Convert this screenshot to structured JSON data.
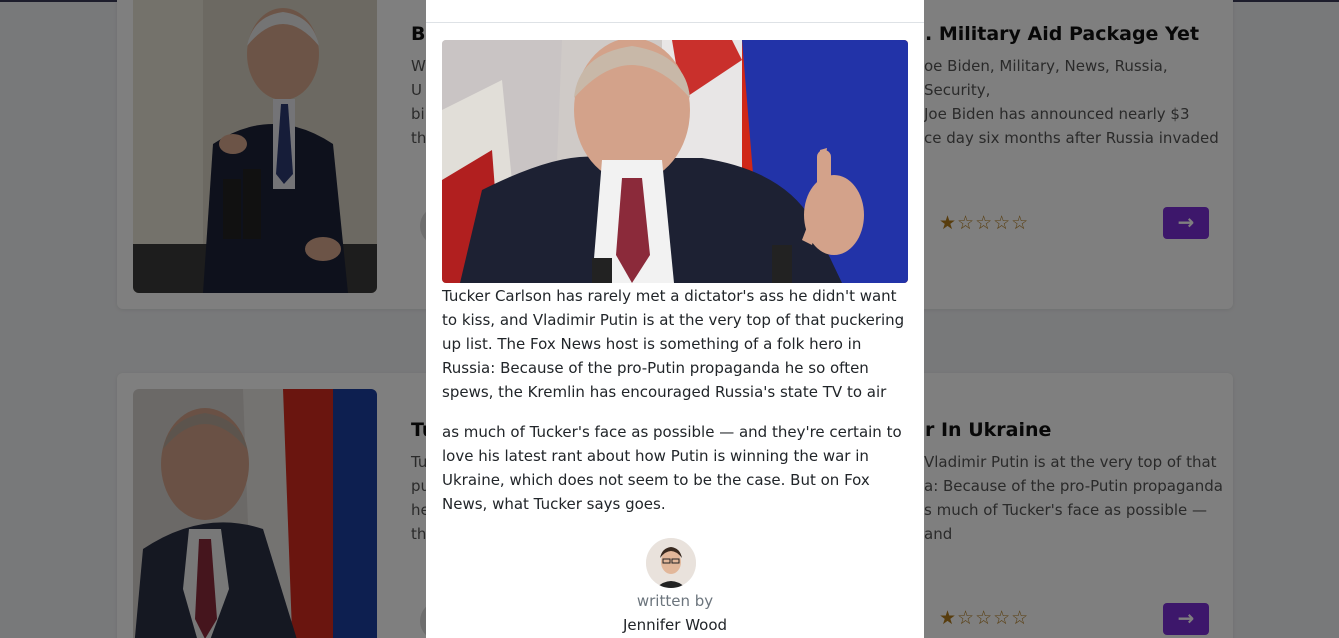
{
  "cards": [
    {
      "title_left": "Bi",
      "title_right": ". Military Aid Package Yet",
      "text_left_lines": [
        "W",
        "U",
        "bi",
        "th"
      ],
      "text_right_lines": [
        "oe Biden, Military, News, Russia, Security,",
        "Joe Biden has announced nearly $3",
        "ce day six months after Russia invaded"
      ],
      "stars": "★☆☆☆☆",
      "button_icon": "arrow-right-icon"
    },
    {
      "title_left": "Tu",
      "title_right": "r In Ukraine",
      "text_left_lines": [
        "Tu",
        "pu",
        "he",
        "th"
      ],
      "text_right_lines": [
        "Vladimir Putin is at the very top of that",
        "a: Because of the pro-Putin propaganda",
        "s much of Tucker's face as possible — and"
      ],
      "stars": "★☆☆☆☆",
      "button_icon": "arrow-right-icon"
    }
  ],
  "modal": {
    "paragraph1": "Tucker Carlson has rarely met a dictator's ass he didn't want to kiss, and Vladimir Putin is at the very top of that puckering up list. The Fox News host is something of a folk hero in Russia: Because of the pro-Putin propaganda he so often spews, the Kremlin has encouraged Russia's state TV to air",
    "paragraph2": "as much of Tucker's face as possible — and they're certain to love his latest rant about how Putin is winning the war in Ukraine, which does not seem to be the case. But on Fox News, what Tucker says goes.",
    "written_by": "written by",
    "author": "Jennifer Wood"
  },
  "colors": {
    "accent": "#7b2fd6",
    "star": "#b07a1c",
    "overlay": "rgba(0,0,0,0.5)"
  }
}
